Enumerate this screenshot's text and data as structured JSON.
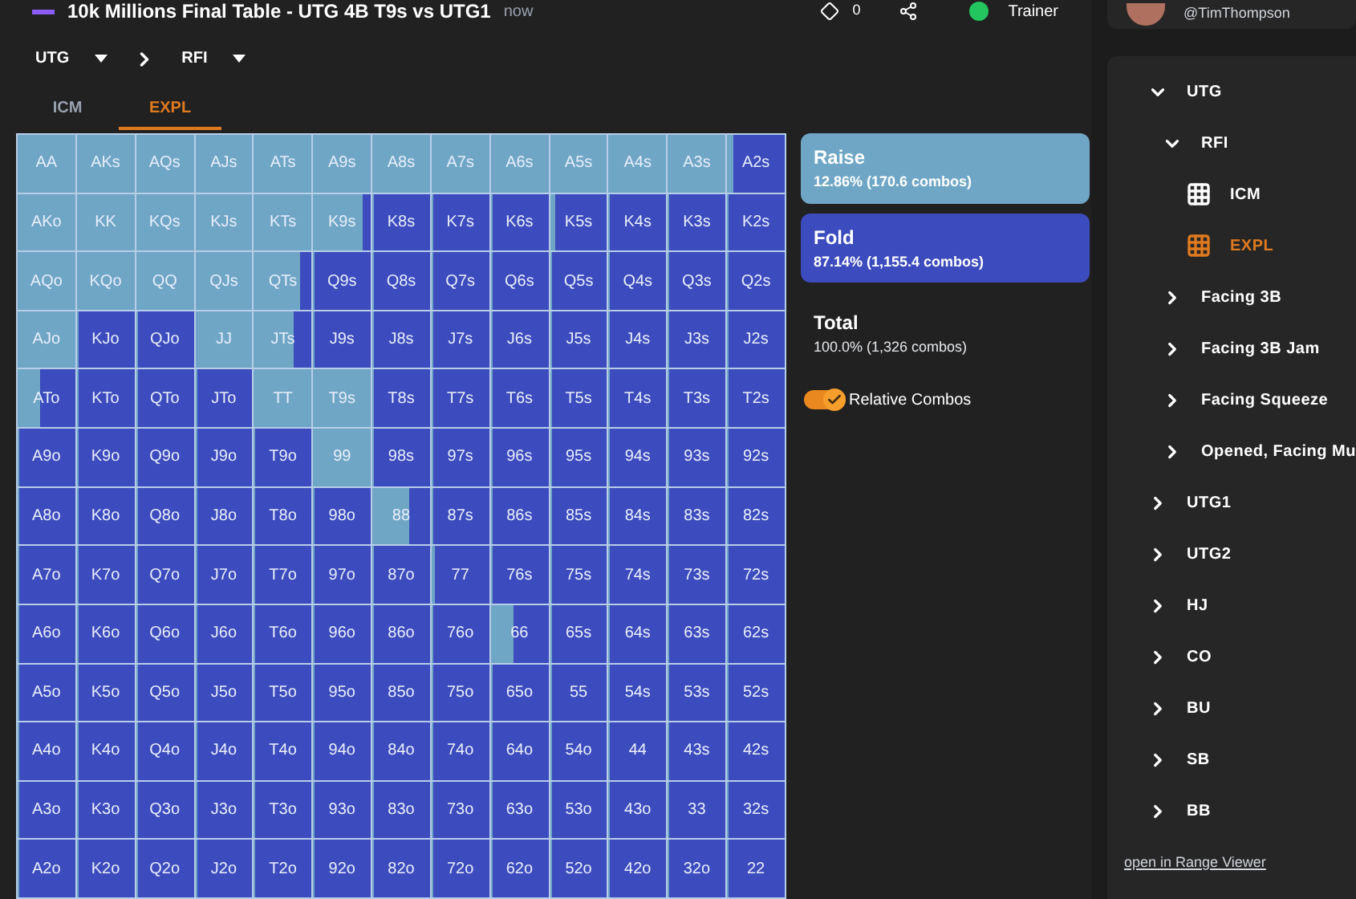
{
  "header": {
    "title": "10k Millions Final Table - UTG 4B T9s vs UTG1",
    "time": "now",
    "badge_count": "0",
    "trainer": "Trainer"
  },
  "breadcrumb": [
    {
      "label": "UTG"
    },
    {
      "label": "RFI"
    }
  ],
  "tabs": [
    {
      "label": "ICM",
      "selected": false
    },
    {
      "label": "EXPL",
      "selected": true
    }
  ],
  "grid": [
    [
      {
        "hand": "AA",
        "level": 1
      },
      {
        "hand": "AKs",
        "level": 1
      },
      {
        "hand": "AQs",
        "level": 1
      },
      {
        "hand": "AJs",
        "level": 1
      },
      {
        "hand": "ATs",
        "level": 1
      },
      {
        "hand": "A9s",
        "level": 1
      },
      {
        "hand": "A8s",
        "level": 1
      },
      {
        "hand": "A7s",
        "level": 1
      },
      {
        "hand": "A6s",
        "level": 1
      },
      {
        "hand": "A5s",
        "level": 1
      },
      {
        "hand": "A4s",
        "level": 1
      },
      {
        "hand": "A3s",
        "level": 1
      },
      {
        "hand": "A2s",
        "level": 0.1
      }
    ],
    [
      {
        "hand": "AKo",
        "level": 1
      },
      {
        "hand": "KK",
        "level": 1
      },
      {
        "hand": "KQs",
        "level": 1
      },
      {
        "hand": "KJs",
        "level": 1
      },
      {
        "hand": "KTs",
        "level": 1
      },
      {
        "hand": "K9s",
        "level": 0.85
      },
      {
        "hand": "K8s",
        "level": 0
      },
      {
        "hand": "K7s",
        "level": 0
      },
      {
        "hand": "K6s",
        "level": 0
      },
      {
        "hand": "K5s",
        "level": 0.1
      },
      {
        "hand": "K4s",
        "level": 0
      },
      {
        "hand": "K3s",
        "level": 0
      },
      {
        "hand": "K2s",
        "level": 0
      }
    ],
    [
      {
        "hand": "AQo",
        "level": 1
      },
      {
        "hand": "KQo",
        "level": 1
      },
      {
        "hand": "QQ",
        "level": 1
      },
      {
        "hand": "QJs",
        "level": 1
      },
      {
        "hand": "QTs",
        "level": 0.8
      },
      {
        "hand": "Q9s",
        "level": 0
      },
      {
        "hand": "Q8s",
        "level": 0
      },
      {
        "hand": "Q7s",
        "level": 0
      },
      {
        "hand": "Q6s",
        "level": 0
      },
      {
        "hand": "Q5s",
        "level": 0
      },
      {
        "hand": "Q4s",
        "level": 0
      },
      {
        "hand": "Q3s",
        "level": 0
      },
      {
        "hand": "Q2s",
        "level": 0
      }
    ],
    [
      {
        "hand": "AJo",
        "level": 1
      },
      {
        "hand": "KJo",
        "level": 0
      },
      {
        "hand": "QJo",
        "level": 0
      },
      {
        "hand": "JJ",
        "level": 1
      },
      {
        "hand": "JTs",
        "level": 0.7
      },
      {
        "hand": "J9s",
        "level": 0
      },
      {
        "hand": "J8s",
        "level": 0
      },
      {
        "hand": "J7s",
        "level": 0
      },
      {
        "hand": "J6s",
        "level": 0
      },
      {
        "hand": "J5s",
        "level": 0
      },
      {
        "hand": "J4s",
        "level": 0
      },
      {
        "hand": "J3s",
        "level": 0
      },
      {
        "hand": "J2s",
        "level": 0
      }
    ],
    [
      {
        "hand": "ATo",
        "level": 0.4
      },
      {
        "hand": "KTo",
        "level": 0
      },
      {
        "hand": "QTo",
        "level": 0
      },
      {
        "hand": "JTo",
        "level": 0
      },
      {
        "hand": "TT",
        "level": 1
      },
      {
        "hand": "T9s",
        "level": 1
      },
      {
        "hand": "T8s",
        "level": 0
      },
      {
        "hand": "T7s",
        "level": 0
      },
      {
        "hand": "T6s",
        "level": 0
      },
      {
        "hand": "T5s",
        "level": 0
      },
      {
        "hand": "T4s",
        "level": 0
      },
      {
        "hand": "T3s",
        "level": 0
      },
      {
        "hand": "T2s",
        "level": 0
      }
    ],
    [
      {
        "hand": "A9o",
        "level": 0
      },
      {
        "hand": "K9o",
        "level": 0
      },
      {
        "hand": "Q9o",
        "level": 0
      },
      {
        "hand": "J9o",
        "level": 0
      },
      {
        "hand": "T9o",
        "level": 0
      },
      {
        "hand": "99",
        "level": 1
      },
      {
        "hand": "98s",
        "level": 0
      },
      {
        "hand": "97s",
        "level": 0
      },
      {
        "hand": "96s",
        "level": 0
      },
      {
        "hand": "95s",
        "level": 0
      },
      {
        "hand": "94s",
        "level": 0
      },
      {
        "hand": "93s",
        "level": 0
      },
      {
        "hand": "92s",
        "level": 0
      }
    ],
    [
      {
        "hand": "A8o",
        "level": 0
      },
      {
        "hand": "K8o",
        "level": 0
      },
      {
        "hand": "Q8o",
        "level": 0
      },
      {
        "hand": "J8o",
        "level": 0
      },
      {
        "hand": "T8o",
        "level": 0
      },
      {
        "hand": "98o",
        "level": 0
      },
      {
        "hand": "88",
        "level": 0.65
      },
      {
        "hand": "87s",
        "level": 0
      },
      {
        "hand": "86s",
        "level": 0
      },
      {
        "hand": "85s",
        "level": 0
      },
      {
        "hand": "84s",
        "level": 0
      },
      {
        "hand": "83s",
        "level": 0
      },
      {
        "hand": "82s",
        "level": 0
      }
    ],
    [
      {
        "hand": "A7o",
        "level": 0
      },
      {
        "hand": "K7o",
        "level": 0
      },
      {
        "hand": "Q7o",
        "level": 0
      },
      {
        "hand": "J7o",
        "level": 0
      },
      {
        "hand": "T7o",
        "level": 0
      },
      {
        "hand": "97o",
        "level": 0
      },
      {
        "hand": "87o",
        "level": 0
      },
      {
        "hand": "77",
        "level": 0.05
      },
      {
        "hand": "76s",
        "level": 0
      },
      {
        "hand": "75s",
        "level": 0
      },
      {
        "hand": "74s",
        "level": 0
      },
      {
        "hand": "73s",
        "level": 0
      },
      {
        "hand": "72s",
        "level": 0
      }
    ],
    [
      {
        "hand": "A6o",
        "level": 0
      },
      {
        "hand": "K6o",
        "level": 0
      },
      {
        "hand": "Q6o",
        "level": 0
      },
      {
        "hand": "J6o",
        "level": 0
      },
      {
        "hand": "T6o",
        "level": 0
      },
      {
        "hand": "96o",
        "level": 0
      },
      {
        "hand": "86o",
        "level": 0
      },
      {
        "hand": "76o",
        "level": 0
      },
      {
        "hand": "66",
        "level": 0.4
      },
      {
        "hand": "65s",
        "level": 0
      },
      {
        "hand": "64s",
        "level": 0
      },
      {
        "hand": "63s",
        "level": 0
      },
      {
        "hand": "62s",
        "level": 0
      }
    ],
    [
      {
        "hand": "A5o",
        "level": 0
      },
      {
        "hand": "K5o",
        "level": 0
      },
      {
        "hand": "Q5o",
        "level": 0
      },
      {
        "hand": "J5o",
        "level": 0
      },
      {
        "hand": "T5o",
        "level": 0
      },
      {
        "hand": "95o",
        "level": 0
      },
      {
        "hand": "85o",
        "level": 0
      },
      {
        "hand": "75o",
        "level": 0
      },
      {
        "hand": "65o",
        "level": 0
      },
      {
        "hand": "55",
        "level": 0.02
      },
      {
        "hand": "54s",
        "level": 0
      },
      {
        "hand": "53s",
        "level": 0
      },
      {
        "hand": "52s",
        "level": 0
      }
    ],
    [
      {
        "hand": "A4o",
        "level": 0
      },
      {
        "hand": "K4o",
        "level": 0
      },
      {
        "hand": "Q4o",
        "level": 0
      },
      {
        "hand": "J4o",
        "level": 0
      },
      {
        "hand": "T4o",
        "level": 0
      },
      {
        "hand": "94o",
        "level": 0
      },
      {
        "hand": "84o",
        "level": 0
      },
      {
        "hand": "74o",
        "level": 0
      },
      {
        "hand": "64o",
        "level": 0
      },
      {
        "hand": "54o",
        "level": 0
      },
      {
        "hand": "44",
        "level": 0
      },
      {
        "hand": "43s",
        "level": 0
      },
      {
        "hand": "42s",
        "level": 0
      }
    ],
    [
      {
        "hand": "A3o",
        "level": 0
      },
      {
        "hand": "K3o",
        "level": 0
      },
      {
        "hand": "Q3o",
        "level": 0
      },
      {
        "hand": "J3o",
        "level": 0
      },
      {
        "hand": "T3o",
        "level": 0
      },
      {
        "hand": "93o",
        "level": 0
      },
      {
        "hand": "83o",
        "level": 0
      },
      {
        "hand": "73o",
        "level": 0
      },
      {
        "hand": "63o",
        "level": 0
      },
      {
        "hand": "53o",
        "level": 0
      },
      {
        "hand": "43o",
        "level": 0
      },
      {
        "hand": "33",
        "level": 0
      },
      {
        "hand": "32s",
        "level": 0
      }
    ],
    [
      {
        "hand": "A2o",
        "level": 0
      },
      {
        "hand": "K2o",
        "level": 0
      },
      {
        "hand": "Q2o",
        "level": 0
      },
      {
        "hand": "J2o",
        "level": 0
      },
      {
        "hand": "T2o",
        "level": 0
      },
      {
        "hand": "92o",
        "level": 0
      },
      {
        "hand": "82o",
        "level": 0
      },
      {
        "hand": "72o",
        "level": 0
      },
      {
        "hand": "62o",
        "level": 0
      },
      {
        "hand": "52o",
        "level": 0
      },
      {
        "hand": "42o",
        "level": 0
      },
      {
        "hand": "32o",
        "level": 0
      },
      {
        "hand": "22",
        "level": 0
      }
    ]
  ],
  "legend": [
    {
      "kind": "raise",
      "label": "Raise",
      "detail": "12.86% (170.6 combos)",
      "color": "#6fa6c6"
    },
    {
      "kind": "fold",
      "label": "Fold",
      "detail": "87.14% (1,155.4 combos)",
      "color": "#3c4bbd"
    },
    {
      "kind": "total",
      "label": "Total",
      "detail": "100.0% (1,326 combos)"
    }
  ],
  "relative_combos": {
    "label": "Relative Combos",
    "on": true
  },
  "user": {
    "handle": "@TimThompson"
  },
  "tree": [
    {
      "kind": "branch",
      "label": "UTG",
      "expanded": true,
      "children": [
        {
          "kind": "branch",
          "label": "RFI",
          "expanded": true,
          "children": [
            {
              "kind": "range",
              "label": "ICM",
              "selected": false
            },
            {
              "kind": "range",
              "label": "EXPL",
              "selected": true
            }
          ]
        },
        {
          "kind": "branch",
          "label": "Facing 3B",
          "expanded": false
        },
        {
          "kind": "branch",
          "label": "Facing 3B Jam",
          "expanded": false
        },
        {
          "kind": "branch",
          "label": "Facing Squeeze",
          "expanded": false
        },
        {
          "kind": "branch",
          "label": "Opened, Facing Mu",
          "expanded": false
        }
      ]
    },
    {
      "kind": "branch",
      "label": "UTG1",
      "expanded": false
    },
    {
      "kind": "branch",
      "label": "UTG2",
      "expanded": false
    },
    {
      "kind": "branch",
      "label": "HJ",
      "expanded": false
    },
    {
      "kind": "branch",
      "label": "CO",
      "expanded": false
    },
    {
      "kind": "branch",
      "label": "BU",
      "expanded": false
    },
    {
      "kind": "branch",
      "label": "SB",
      "expanded": false
    },
    {
      "kind": "branch",
      "label": "BB",
      "expanded": false
    }
  ],
  "footer_link": "open in Range Viewer"
}
